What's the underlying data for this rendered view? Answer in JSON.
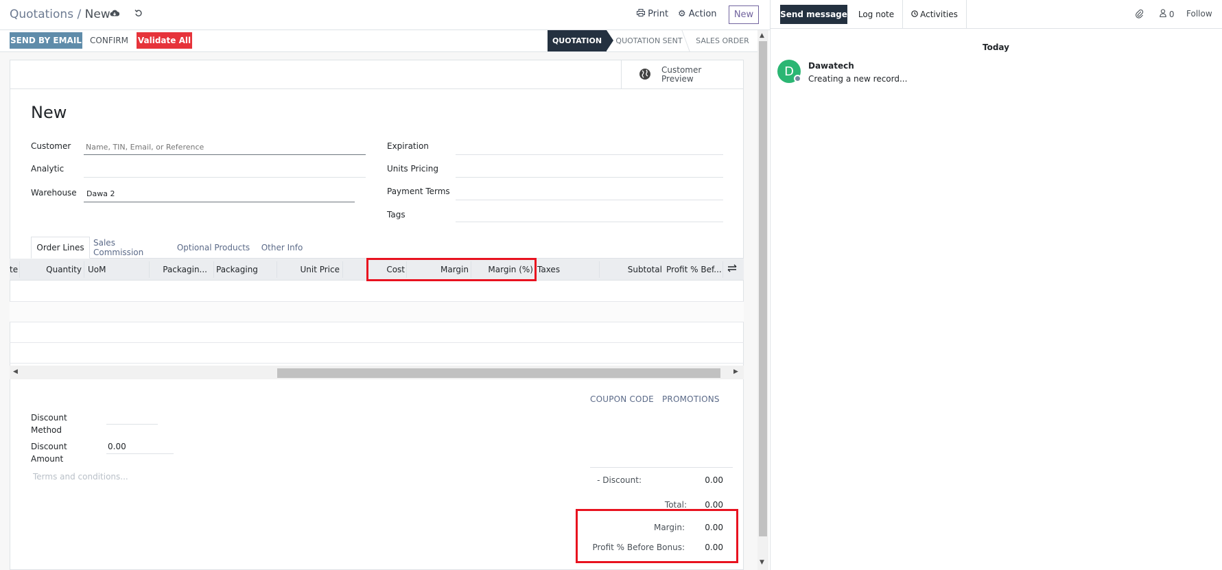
{
  "breadcrumb": {
    "parent": "Quotations",
    "separator": "/",
    "current": "New"
  },
  "toolbar": {
    "print_label": "Print",
    "action_label": "Action",
    "new_label": "New"
  },
  "statusbar": {
    "send_email_label": "SEND BY EMAIL",
    "confirm_label": "CONFIRM",
    "validate_label": "Validate All",
    "stages": [
      "QUOTATION",
      "QUOTATION SENT",
      "SALES ORDER"
    ],
    "active_stage": "QUOTATION"
  },
  "button_box": {
    "customer_preview_label": "Customer Preview"
  },
  "form": {
    "title": "New",
    "left_fields": [
      {
        "label": "Customer",
        "value": "",
        "placeholder": "Name, TIN, Email, or Reference"
      },
      {
        "label": "Analytic",
        "value": ""
      },
      {
        "label": "Warehouse",
        "value": "Dawa 2"
      }
    ],
    "right_fields": [
      {
        "label": "Expiration",
        "value": ""
      },
      {
        "label": "Units Pricing",
        "value": ""
      },
      {
        "label": "Payment Terms",
        "value": ""
      },
      {
        "label": "Tags",
        "value": ""
      }
    ]
  },
  "tabs": [
    "Order Lines",
    "Sales Commission",
    "Optional Products",
    "Other Info"
  ],
  "active_tab": "Order Lines",
  "table": {
    "columns": [
      "te",
      "Quantity",
      "UoM",
      "Packagin...",
      "Packaging",
      "Unit Price",
      "Cost",
      "Margin",
      "Margin (%)",
      "Taxes",
      "Subtotal",
      "Profit % Bef..."
    ],
    "rows": []
  },
  "footer": {
    "coupon_label": "COUPON CODE",
    "promotions_label": "PROMOTIONS",
    "discount_method_label": "Discount Method",
    "discount_method_value": "",
    "discount_amount_label": "Discount Amount",
    "discount_amount_value": "0.00",
    "terms_placeholder": "Terms and conditions...",
    "totals": [
      {
        "label": "- Discount:",
        "value": "0.00"
      },
      {
        "label": "Total:",
        "value": "0.00"
      },
      {
        "label": "Margin:",
        "value": "0.00"
      },
      {
        "label": "Profit % Before Bonus:",
        "value": "0.00"
      }
    ]
  },
  "chatter": {
    "send_message_label": "Send message",
    "log_note_label": "Log note",
    "activities_label": "Activities",
    "followers_count": "0",
    "follow_label": "Follow",
    "date_separator": "Today",
    "messages": [
      {
        "author": "Dawatech",
        "avatar_letter": "D",
        "body": "Creating a new record..."
      }
    ]
  },
  "colors": {
    "brand": "#71639e",
    "highlight": "#e8121f",
    "stage_active": "#243140",
    "send_email": "#5f8caa",
    "validate": "#e6333a"
  },
  "icons": [
    "cloud-save-icon",
    "discard-icon",
    "print-icon",
    "gear-icon",
    "globe-icon",
    "column-settings-icon",
    "paperclip-icon",
    "followers-icon",
    "clock-icon"
  ]
}
